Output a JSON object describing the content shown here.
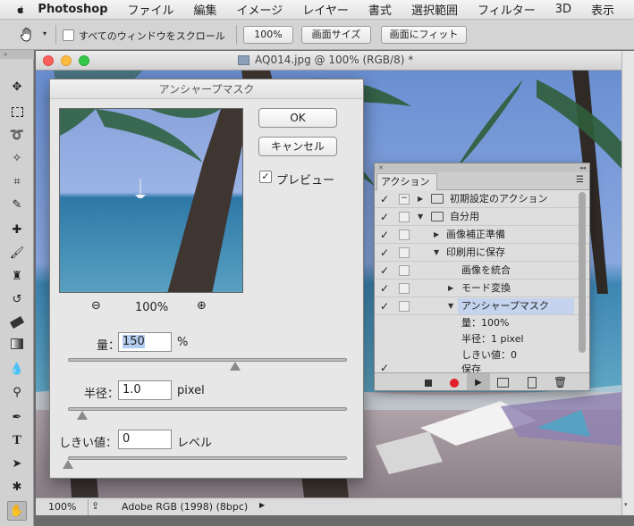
{
  "menubar": {
    "app_name": "Photoshop",
    "items": [
      "ファイル",
      "編集",
      "イメージ",
      "レイヤー",
      "書式",
      "選択範囲",
      "フィルター",
      "3D",
      "表示"
    ]
  },
  "options_bar": {
    "scroll_all_windows_label": "すべてのウィンドウをスクロール",
    "btn_100": "100%",
    "btn_screen_size": "画面サイズ",
    "btn_fit_screen": "画面にフィット"
  },
  "document": {
    "title": "AQ014.jpg @ 100% (RGB/8) *",
    "status_zoom": "100%",
    "status_profile": "Adobe RGB (1998) (8bpc)"
  },
  "dialog": {
    "title": "アンシャープマスク",
    "ok_label": "OK",
    "cancel_label": "キャンセル",
    "preview_label": "プレビュー",
    "preview_checked": true,
    "zoom_label": "100%",
    "amount_label": "量：",
    "amount_value": "150",
    "amount_unit": "%",
    "amount_fraction": 0.6,
    "radius_label": "半径：",
    "radius_value": "1.0",
    "radius_unit": "pixel",
    "radius_fraction": 0.05,
    "threshold_label": "しきい値：",
    "threshold_value": "0",
    "threshold_unit": "レベル",
    "threshold_fraction": 0.0
  },
  "actions_panel": {
    "tab_label": "アクション",
    "rows": [
      {
        "check": "✓",
        "label": "初期設定のアクション",
        "type": "set",
        "expanded": false
      },
      {
        "check": "✓",
        "label": "自分用",
        "type": "set",
        "expanded": true
      },
      {
        "check": "✓",
        "label": "画像補正準備",
        "type": "action",
        "expanded": false
      },
      {
        "check": "✓",
        "label": "印刷用に保存",
        "type": "action",
        "expanded": true
      },
      {
        "check": "✓",
        "label": "画像を統合",
        "type": "step",
        "expanded": false
      },
      {
        "check": "✓",
        "label": "モード変換",
        "type": "step",
        "expanded": false
      },
      {
        "check": "✓",
        "label": "アンシャープマスク",
        "type": "step",
        "expanded": true,
        "selected": true
      }
    ],
    "sub_items": [
      "量：100%",
      "半径：1 pixel",
      "しきい値：0"
    ],
    "partial_row": {
      "check": "✓",
      "label": "保存"
    }
  },
  "colors": {
    "selected_row": "#c5d3ee",
    "record_red": "#e0202a",
    "traffic_close": "#fc605c",
    "traffic_min": "#fdbc40",
    "traffic_max": "#34c84a"
  }
}
